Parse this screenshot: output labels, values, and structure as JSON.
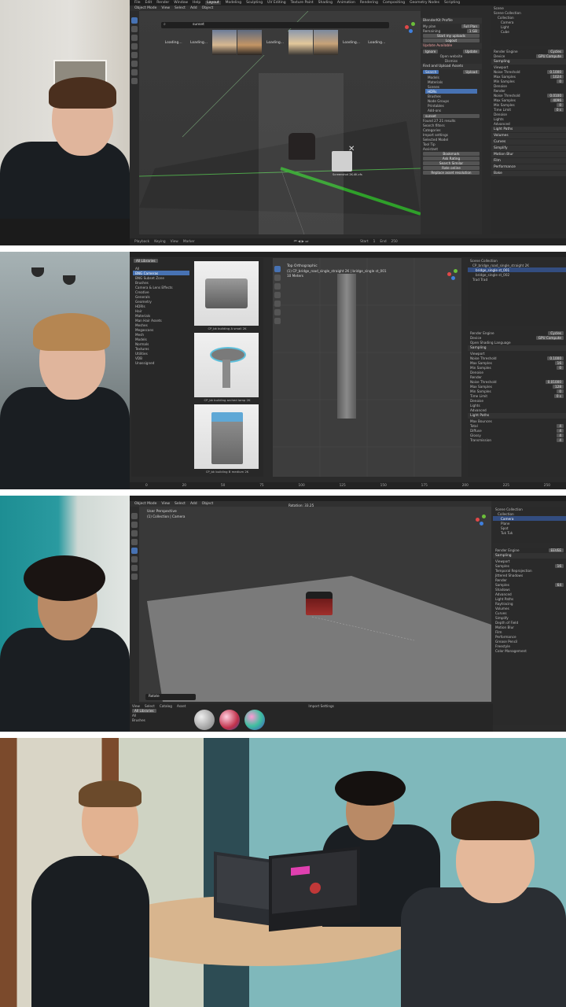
{
  "panel1": {
    "menu": [
      "File",
      "Edit",
      "Render",
      "Window",
      "Help",
      "Layout",
      "Modeling",
      "Sculpting",
      "UV Editing",
      "Texture Paint",
      "Shading",
      "Animation",
      "Rendering",
      "Compositing",
      "Geometry Nodes",
      "Scripting"
    ],
    "header": [
      "Object Mode",
      "View",
      "Select",
      "Add",
      "Object"
    ],
    "search_value": "sunset",
    "thumbs": [
      "Loading...",
      "Loading...",
      "",
      "",
      "Loading...",
      "",
      "",
      "Loading...",
      "Loading..."
    ],
    "addon": {
      "title": "BlenderKit Profile",
      "rows": [
        [
          "My plan",
          "Full Plan"
        ],
        [
          "Remaining",
          "1 GB"
        ]
      ],
      "buttons": [
        "Start my uploads",
        "Logout"
      ],
      "update_available": "Update Available",
      "update_buttons": [
        "Ignore",
        "Update"
      ],
      "update_links": [
        "Open website",
        "Dismiss"
      ],
      "section_find": "Find and Upload Assets",
      "tabs": [
        "Search",
        "Upload"
      ],
      "categories": [
        "Models",
        "Materials",
        "Scenes",
        "HDRs",
        "Brushes",
        "Node Groups",
        "Printables",
        "Add-ons"
      ],
      "search_label": "sunset",
      "found": "Found 27 21 results",
      "filters": [
        "Search filters",
        "Categories",
        "Import settings"
      ],
      "selected_model": "Selected Model",
      "tool_tip": "Tool Tip",
      "assistant": "Assistant",
      "assistant_buttons": [
        "Bookmark",
        "Ask Rating",
        "Search Similar",
        "Rate online",
        "Replace asset resolution"
      ]
    },
    "outliner": [
      "Scene",
      "Scene Collection",
      "Collection",
      "Camera",
      "Light",
      "Cube"
    ],
    "render_props": {
      "engine_label": "Render Engine",
      "engine": "Cycles",
      "device_label": "Device",
      "device": "GPU Compute",
      "sampling": "Sampling",
      "viewport": "Viewport",
      "noise_threshold_label": "Noise Threshold",
      "noise_threshold": "0.1000",
      "max_samples_label": "Max Samples",
      "max_samples": "1024",
      "min_samples_label": "Min Samples",
      "min_samples": "0",
      "denoise": "Denoise",
      "render": "Render",
      "render_noise_threshold": "0.0100",
      "render_max_samples": "4096",
      "render_min_samples": "0",
      "time_limit_label": "Time Limit",
      "time_limit": "0 s",
      "more": [
        "Denoise",
        "Lights",
        "Advanced",
        "Light Paths",
        "Volumes",
        "Curves",
        "Simplify",
        "Motion Blur",
        "Film",
        "Performance",
        "Bake"
      ]
    },
    "timeline": [
      "Playback",
      "Keying",
      "View",
      "Marker"
    ],
    "frame": {
      "start": "Start",
      "start_val": "1",
      "end": "End",
      "end_val": "250"
    },
    "asset_label": "Screenshot 2K-4K.cfs"
  },
  "panel2": {
    "library_label": "All Libraries",
    "tree": [
      "All",
      "BNG Cameras",
      "BNG Subset Zone",
      "Brushes",
      "Camera & Lens Effects",
      "Creative",
      "Generals",
      "Geometry",
      "HDRIs",
      "Hair",
      "Materials",
      "Man Hair Assets",
      "Meshes",
      "Megascans",
      "Mesh",
      "Models",
      "Normals",
      "Textures",
      "Utilities",
      "VDB",
      "Unassigned"
    ],
    "assets": [
      "CP_bk building A small 2K",
      "CP_bk building arched lamp 2K",
      "CP_bk building B medium 2K"
    ],
    "view_label": "Top Orthographic",
    "view_sub": "(1) CP_bridge_road_single_straight 2K | bridge_single st_001",
    "view_unit": "10 Meters",
    "outliner": [
      "Scene Collection",
      "CP_bridge_road_single_straight 2K",
      "bridge_single st_001",
      "bridge_single st_002",
      "Trad Trad"
    ],
    "render_props": {
      "engine_label": "Render Engine",
      "engine": "Cycles",
      "device_label": "Device",
      "device": "GPU Compute",
      "osl": "Open Shading Language",
      "sampling": "Sampling",
      "viewport": "Viewport",
      "noise_threshold_label": "Noise Threshold",
      "noise_threshold": "0.1000",
      "max_samples_label": "Max Samples",
      "max_samples": "16",
      "min_samples_label": "Min Samples",
      "min_samples": "0",
      "denoise": "Denoise",
      "render": "Render",
      "render_noise_threshold": "0.01000",
      "render_max_samples": "128",
      "render_min_samples": "0",
      "time_limit_label": "Time Limit",
      "time_limit": "0 s",
      "more": [
        "Denoise",
        "Lights",
        "Advanced",
        "Light Paths",
        "Max Bounces"
      ],
      "bounces": [
        [
          "Total",
          "4"
        ],
        [
          "Diffuse",
          "4"
        ],
        [
          "Glossy",
          "4"
        ],
        [
          "Transmission",
          "4"
        ]
      ]
    },
    "ruler": [
      "0",
      "20",
      "50",
      "75",
      "100",
      "125",
      "150",
      "175",
      "200",
      "225",
      "250"
    ]
  },
  "panel3": {
    "header": [
      "Object Mode",
      "View",
      "Select",
      "Add",
      "Object"
    ],
    "view_label": "User Perspective",
    "view_sub": "(1) Collection | Camera",
    "rotation": "Rotation: 33.25",
    "outliner": [
      "Scene Collection",
      "Collection",
      "Camera",
      "Plane",
      "Spot",
      "Tuk Tuk"
    ],
    "render_props": {
      "engine_label": "Render Engine",
      "engine": "EEVEE",
      "sampling": "Sampling",
      "viewport": "Viewport",
      "samples_label": "Samples",
      "samples": "16",
      "temporal": "Temporal Reprojection",
      "jittered": "Jittered Shadows",
      "render": "Render",
      "render_samples": "64",
      "more": [
        "Shadows",
        "Advanced",
        "Light Paths",
        "Raytracing",
        "Volumes",
        "Curves",
        "Simplify",
        "Depth of Field",
        "Motion Blur",
        "Film",
        "Performance",
        "Grease Pencil",
        "Freestyle",
        "Color Management"
      ]
    },
    "asset_bar": [
      "View",
      "Select",
      "Catalog",
      "Asset"
    ],
    "asset_lib": "All Libraries",
    "asset_tree": [
      "All",
      "Brushes"
    ],
    "import": "Import Settings",
    "bottom_label": "Rotate"
  }
}
